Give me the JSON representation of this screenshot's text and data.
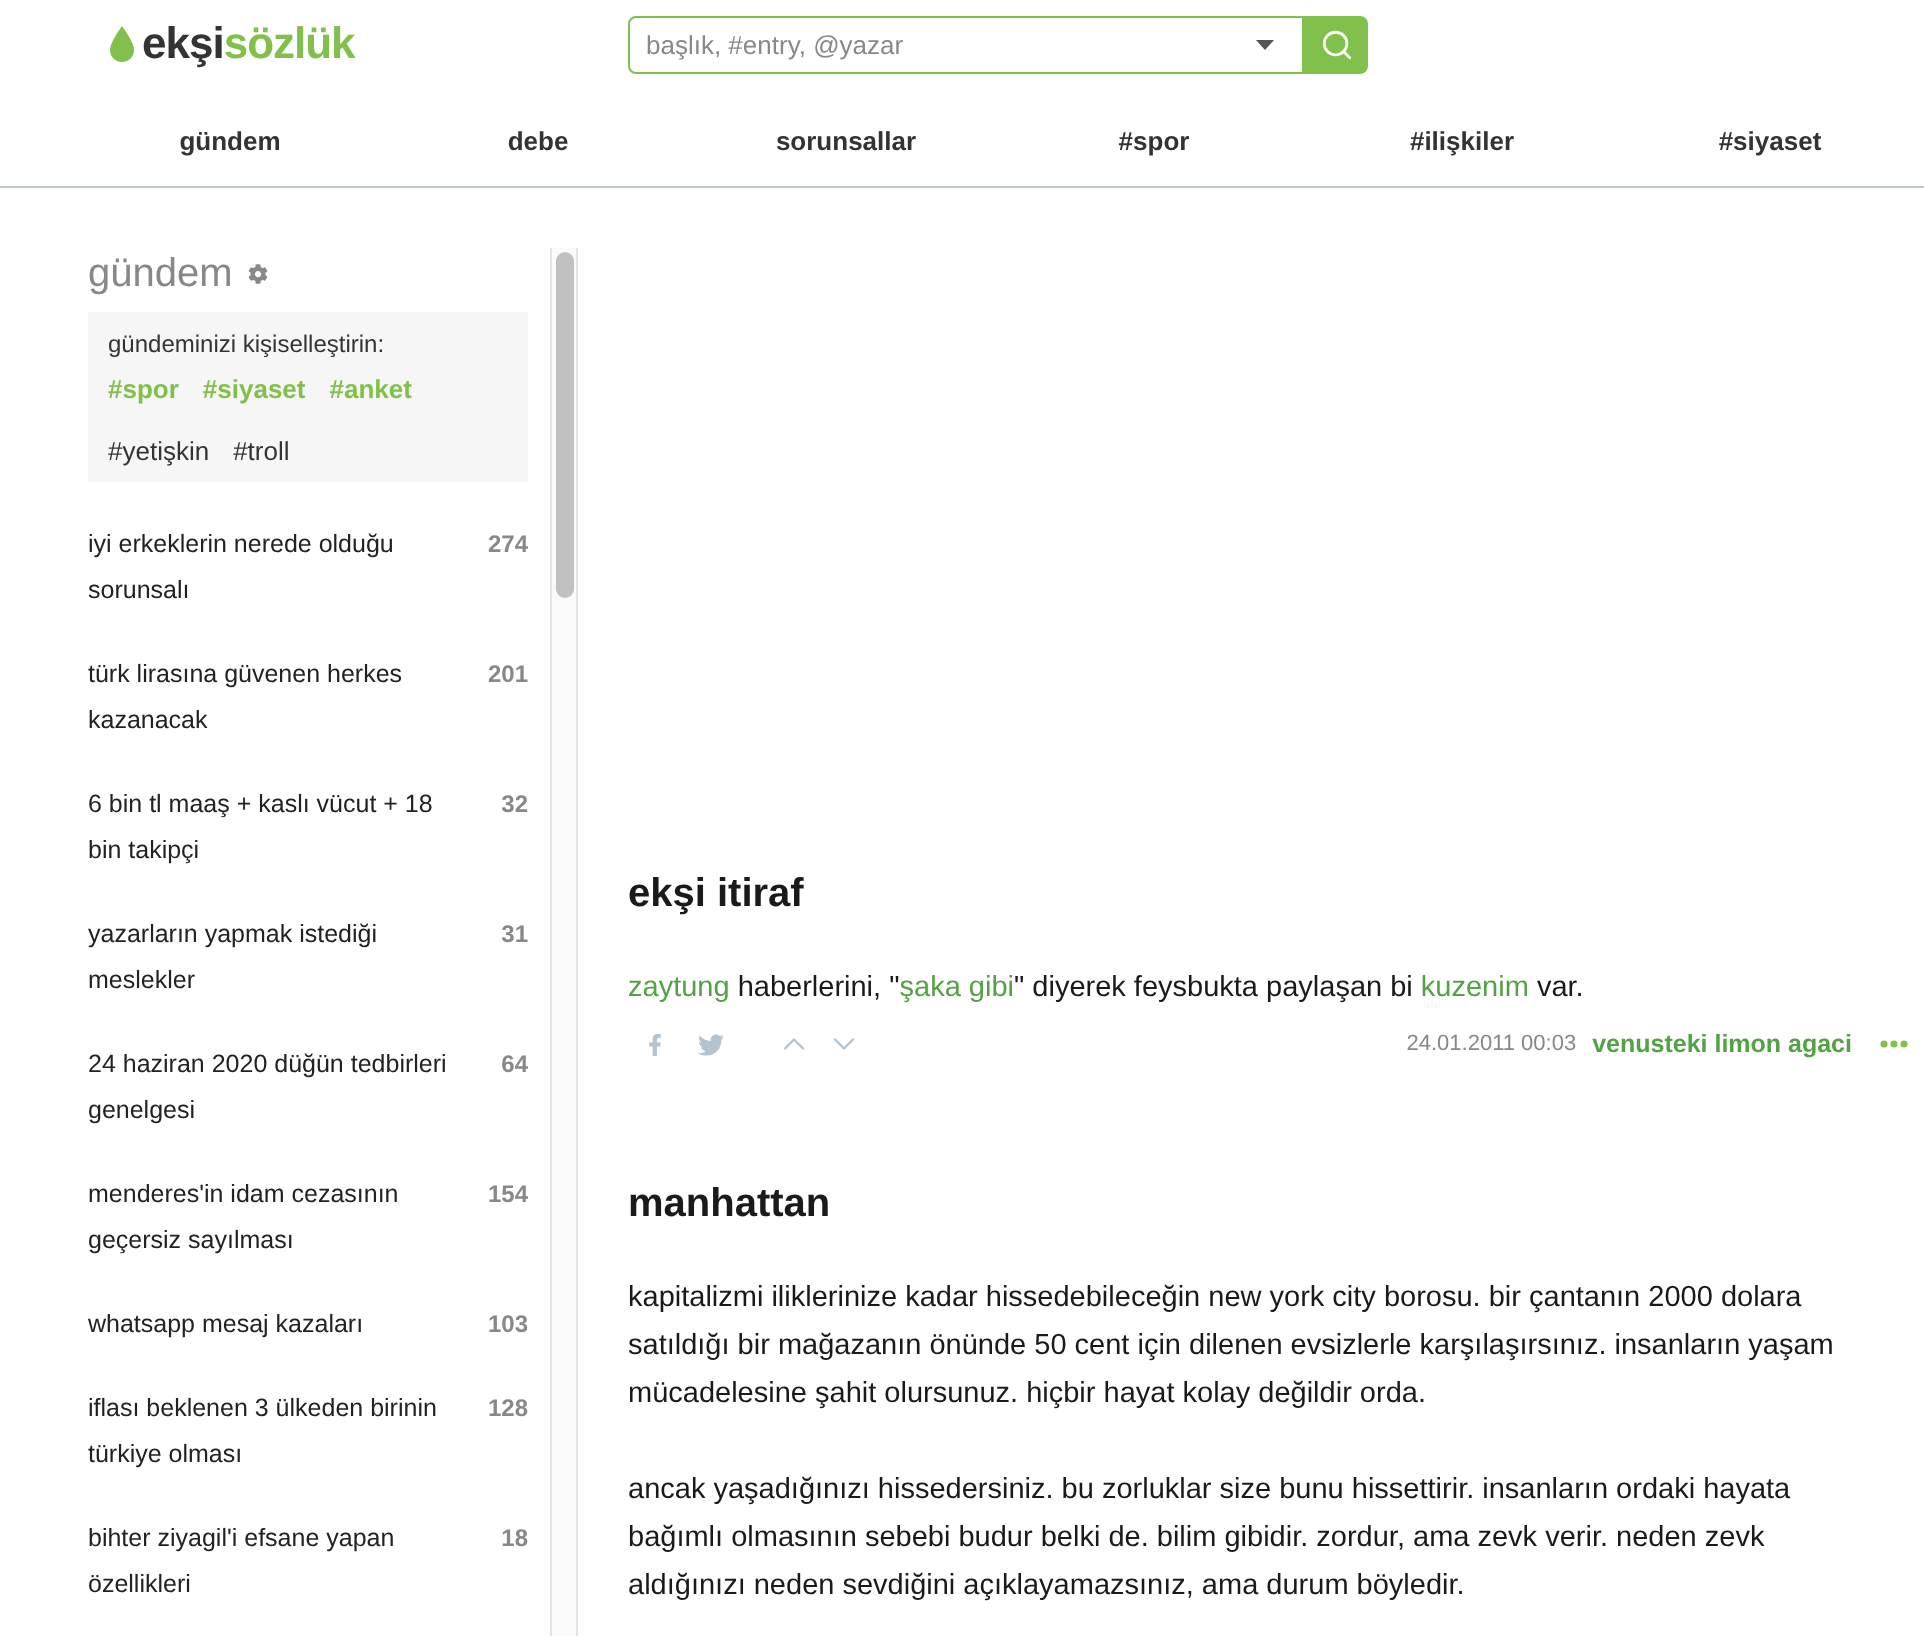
{
  "header": {
    "logo": {
      "first": "ekşi",
      "second": "sözlük"
    },
    "search": {
      "placeholder": "başlık, #entry, @yazar"
    }
  },
  "nav": [
    "gündem",
    "debe",
    "sorunsallar",
    "#spor",
    "#ilişkiler",
    "#siyaset"
  ],
  "sidebar": {
    "title": "gündem",
    "personalize": {
      "label": "gündeminizi kişiselleştirin:",
      "tags": [
        {
          "label": "#spor",
          "selected": true
        },
        {
          "label": "#siyaset",
          "selected": true
        },
        {
          "label": "#anket",
          "selected": true
        },
        {
          "label": "#yetişkin",
          "selected": false
        },
        {
          "label": "#troll",
          "selected": false
        }
      ]
    },
    "topics": [
      {
        "title": "iyi erkeklerin nerede olduğu sorunsalı",
        "count": "274"
      },
      {
        "title": "türk lirasına güvenen herkes kazanacak",
        "count": "201"
      },
      {
        "title": "6 bin tl maaş + kaslı vücut + 18 bin takipçi",
        "count": "32"
      },
      {
        "title": "yazarların yapmak istediği meslekler",
        "count": "31"
      },
      {
        "title": "24 haziran 2020 düğün tedbirleri genelgesi",
        "count": "64"
      },
      {
        "title": "menderes'in idam cezasının geçersiz sayılması",
        "count": "154"
      },
      {
        "title": "whatsapp mesaj kazaları",
        "count": "103"
      },
      {
        "title": "iflası beklenen 3 ülkeden birinin türkiye olması",
        "count": "128"
      },
      {
        "title": "bihter ziyagil'i efsane yapan özellikleri",
        "count": "18"
      }
    ]
  },
  "entries": [
    {
      "title": "ekşi itiraf",
      "paragraphs": [
        [
          {
            "text": "zaytung",
            "link": true
          },
          {
            "text": " haberlerini, \"",
            "link": false
          },
          {
            "text": "şaka gibi",
            "link": true
          },
          {
            "text": "\" diyerek feysbukta paylaşan bi ",
            "link": false
          },
          {
            "text": "kuzenim",
            "link": true
          },
          {
            "text": " var.",
            "link": false
          }
        ]
      ],
      "date": "24.01.2011 00:03",
      "author": "venusteki limon agaci"
    },
    {
      "title": "manhattan",
      "paragraphs": [
        [
          {
            "text": "kapitalizmi iliklerinize kadar hissedebileceğin new york city borosu. bir çantanın 2000 dolara satıldığı bir mağazanın önünde 50 cent için dilenen evsizlerle karşılaşırsınız. insanların yaşam mücadelesine şahit olursunuz. hiçbir hayat kolay değildir orda.",
            "link": false
          }
        ],
        [
          {
            "text": "ancak yaşadığınızı hissedersiniz. bu zorluklar size bunu hissettirir. insanların ordaki hayata bağımlı olmasının sebebi budur belki de. bilim gibidir. zordur, ama zevk verir. neden zevk aldığınızı neden sevdiğini açıklayamazsınız, ama durum böyledir.",
            "link": false
          }
        ]
      ]
    }
  ]
}
